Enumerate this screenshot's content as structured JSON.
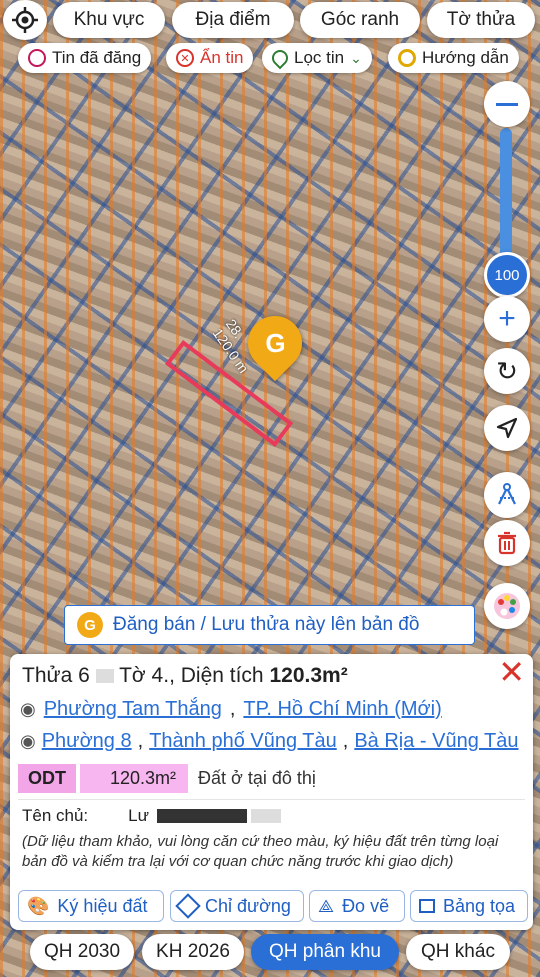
{
  "top_filters": [
    "Khu vực",
    "Địa điểm",
    "Góc ranh",
    "Tờ thửa"
  ],
  "chips": {
    "posted": "Tin đã đăng",
    "hidden": "Ẩn tin",
    "filter": "Lọc tin",
    "guide": "Hướng dẫn"
  },
  "map": {
    "zoom_level": "100",
    "parcel_label_top": "28.",
    "parcel_label_bottom": "120.0 m",
    "post_banner": "Đăng bán / Lưu thửa này lên bản đồ"
  },
  "info": {
    "parcel_prefix": "Thửa",
    "parcel_no": "6",
    "sheet_prefix": "Tờ",
    "sheet_no": "4",
    "area_prefix": "., Diện tích",
    "area": "120.3m²",
    "new_ward": "Phường Tam Thắng",
    "new_city": "TP. Hồ Chí Minh (Mới)",
    "old_ward": "Phường 8",
    "old_city": "Thành phố Vũng Tàu",
    "old_province": "Bà Rịa - Vũng Tàu",
    "land_code": "ODT",
    "land_area": "120.3m²",
    "land_desc": "Đất ở tại đô thị",
    "owner_label": "Tên chủ:",
    "owner_value": "Lư",
    "note": "(Dữ liệu tham khảo, vui lòng căn cứ theo màu, ký hiệu đất trên từng loại bản đồ và kiểm tra lại với cơ quan chức năng trước khi giao dịch)",
    "actions": [
      "Ký hiệu đất",
      "Chỉ đường",
      "Đo vẽ",
      "Bảng tọa"
    ]
  },
  "bottom_tabs": [
    "QH 2030",
    "KH 2026",
    "QH phân khu",
    "QH khác"
  ],
  "colors": {
    "accent": "#2a6fd6",
    "active_tab": "#2a6fd6",
    "close": "#d9342b",
    "odt_bg": "#f2a6e8",
    "pin": "#f2a916"
  }
}
